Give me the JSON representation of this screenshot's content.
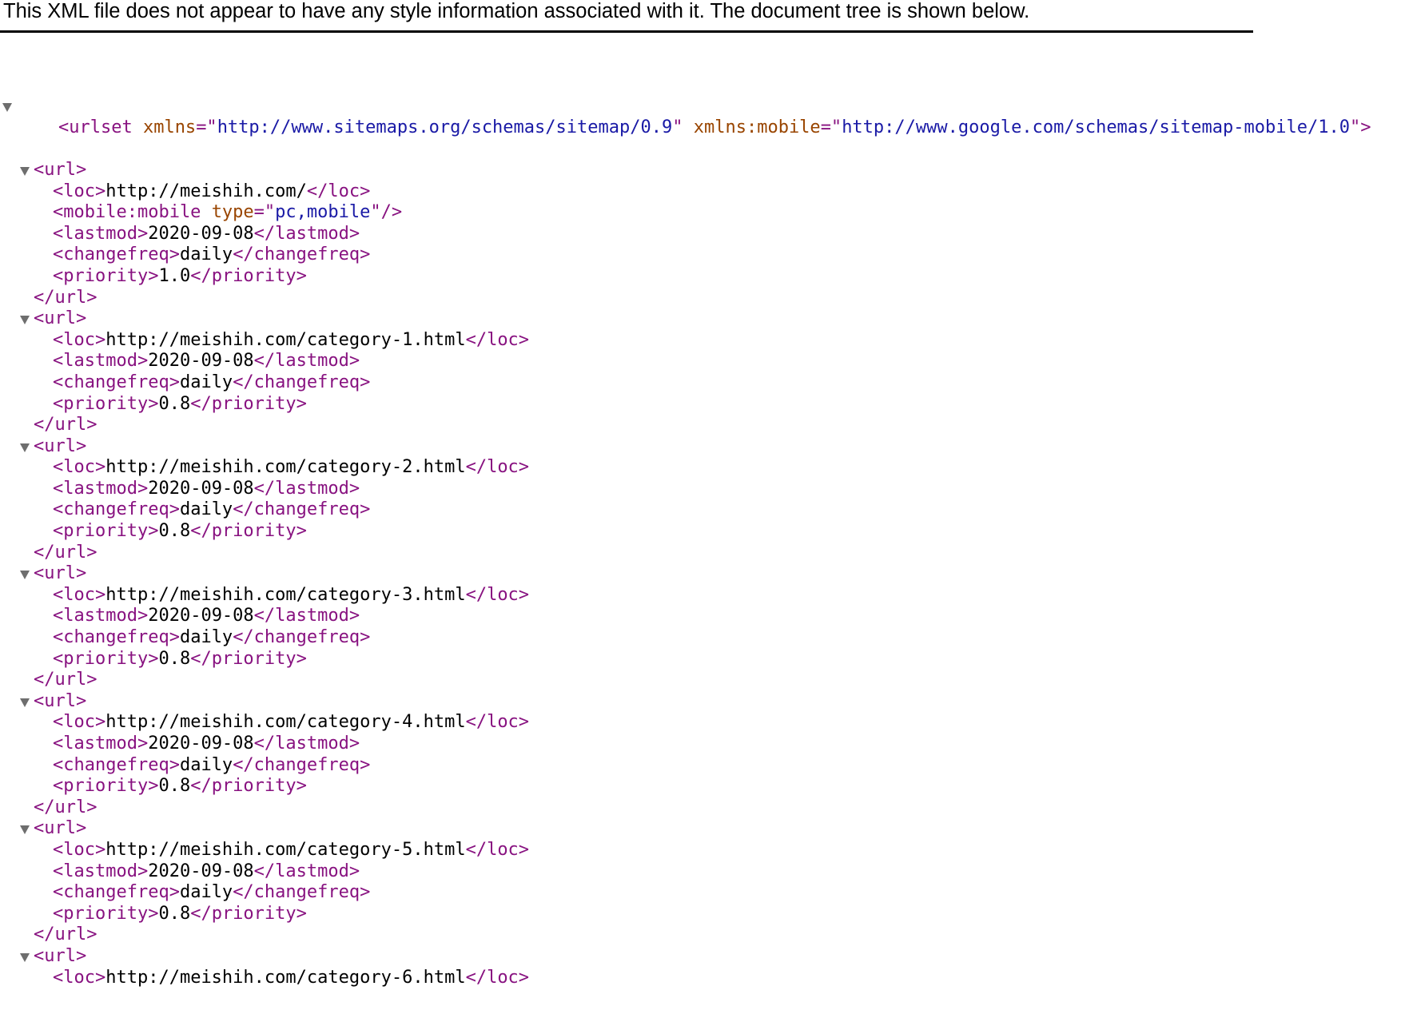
{
  "notice": "This XML file does not appear to have any style information associated with it. The document tree is shown below.",
  "root": {
    "open_tag": "<urlset",
    "attrs": [
      {
        "name": "xmlns",
        "value": "http://www.sitemaps.org/schemas/sitemap/0.9"
      },
      {
        "name": "xmlns:mobile",
        "value": "http://www.google.com/schemas/sitemap-mobile/1.0"
      }
    ],
    "close": ">"
  },
  "urls": [
    {
      "open": "<url>",
      "loc": "http://meishih.com/",
      "mobile_tag": "<mobile:mobile",
      "mobile_attr": "type",
      "mobile_value": "pc,mobile",
      "lastmod": "2020-09-08",
      "changefreq": "daily",
      "priority": "1.0",
      "close": "</url>"
    },
    {
      "open": "<url>",
      "loc": "http://meishih.com/category-1.html",
      "lastmod": "2020-09-08",
      "changefreq": "daily",
      "priority": "0.8",
      "close": "</url>"
    },
    {
      "open": "<url>",
      "loc": "http://meishih.com/category-2.html",
      "lastmod": "2020-09-08",
      "changefreq": "daily",
      "priority": "0.8",
      "close": "</url>"
    },
    {
      "open": "<url>",
      "loc": "http://meishih.com/category-3.html",
      "lastmod": "2020-09-08",
      "changefreq": "daily",
      "priority": "0.8",
      "close": "</url>"
    },
    {
      "open": "<url>",
      "loc": "http://meishih.com/category-4.html",
      "lastmod": "2020-09-08",
      "changefreq": "daily",
      "priority": "0.8",
      "close": "</url>"
    },
    {
      "open": "<url>",
      "loc": "http://meishih.com/category-5.html",
      "lastmod": "2020-09-08",
      "changefreq": "daily",
      "priority": "0.8",
      "close": "</url>"
    },
    {
      "open": "<url>",
      "loc": "http://meishih.com/category-6.html",
      "close": ""
    }
  ],
  "tags": {
    "loc_open": "<loc>",
    "loc_close": "</loc>",
    "lastmod_open": "<lastmod>",
    "lastmod_close": "</lastmod>",
    "changefreq_open": "<changefreq>",
    "changefreq_close": "</changefreq>",
    "priority_open": "<priority>",
    "priority_close": "</priority>",
    "mobile_end": "/>"
  },
  "colors": {
    "tag": "#881280",
    "attribute_name": "#994500",
    "attribute_value": "#1a1aa6",
    "text": "#000000",
    "toggle": "#6e6e6e"
  },
  "icons": {
    "collapse_toggle": "triangle-down-icon"
  }
}
